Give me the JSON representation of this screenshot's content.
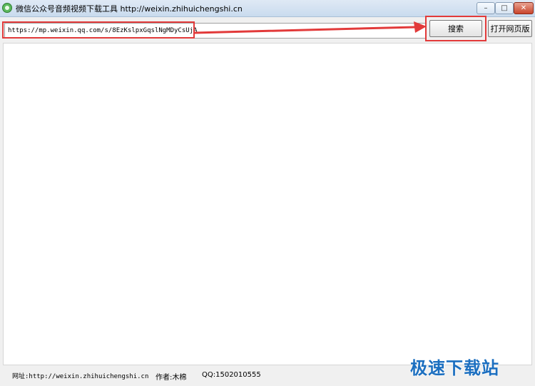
{
  "window": {
    "title": "微信公众号音频视频下载工具 http://weixin.zhihuichengshi.cn",
    "controls": {
      "minimize": "–",
      "maximize": "□",
      "close": "✕"
    }
  },
  "toolbar": {
    "url_value": "https://mp.weixin.qq.com/s/8EzKslpxGqslNgMDyCsUjA",
    "search_label": "搜索",
    "open_page_label": "打开网页版"
  },
  "status": {
    "site": "网址:http://weixin.zhihuichengshi.cn",
    "author": "作者:木棉",
    "qq": "QQ:1502010555"
  },
  "watermark": "极速下载站",
  "colors": {
    "highlight": "#e23a3a",
    "watermark": "#1c6fc0"
  }
}
